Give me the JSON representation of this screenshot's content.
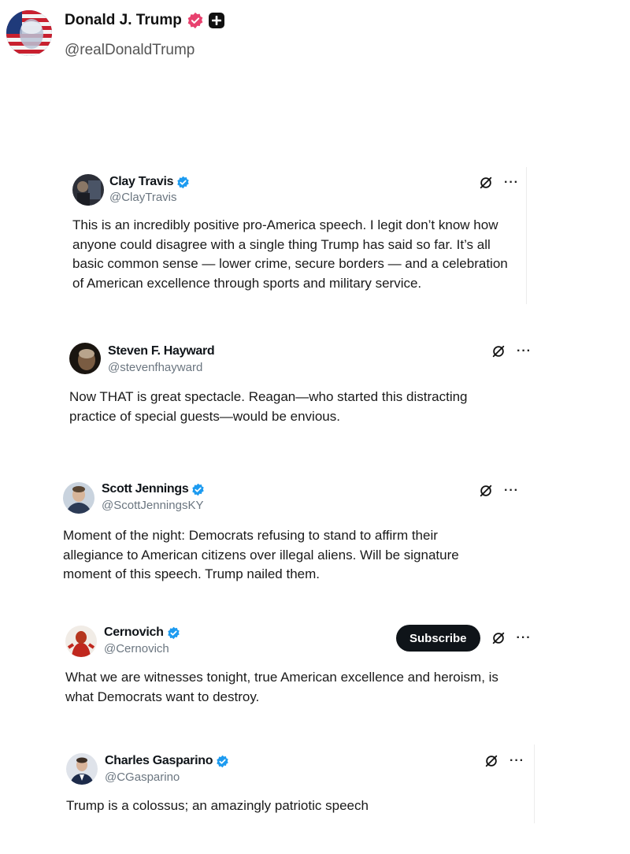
{
  "post": {
    "author_name": "Donald J. Trump",
    "author_handle": "@realDonaldTrump"
  },
  "tweets": [
    {
      "name": "Clay Travis",
      "handle": "@ClayTravis",
      "verified": true,
      "lines": [
        "This is an incredibly positive pro-America speech. I legit don’t know how",
        "anyone could disagree with a single thing Trump has said so far. It’s all",
        "basic common sense — lower crime, secure borders — and a celebration",
        "of American excellence through sports and military service."
      ]
    },
    {
      "name": "Steven F. Hayward",
      "handle": "@stevenfhayward",
      "verified": false,
      "lines": [
        "Now THAT is great spectacle. Reagan—who started this distracting",
        "practice of special guests—would be envious."
      ]
    },
    {
      "name": "Scott Jennings",
      "handle": "@ScottJenningsKY",
      "verified": true,
      "lines": [
        "Moment of the night: Democrats refusing to stand to affirm their",
        "allegiance to American citizens over illegal aliens. Will be signature",
        "moment of this speech. Trump nailed them."
      ]
    },
    {
      "name": "Cernovich",
      "handle": "@Cernovich",
      "verified": true,
      "subscribe_label": "Subscribe",
      "lines": [
        "What we are witnesses tonight, true American excellence and heroism, is",
        "what Democrats want to destroy."
      ]
    },
    {
      "name": "Charles Gasparino",
      "handle": "@CGasparino",
      "verified": true,
      "lines": [
        "Trump is a colossus; an amazingly patriotic speech"
      ]
    }
  ],
  "icons": {
    "verified_pink": "verified-badge-icon",
    "plus_badge": "plus-badge-icon",
    "verified_blue": "verified-check-icon",
    "grok": "grok-icon",
    "more": "more-icon"
  },
  "colors": {
    "verified_pink": "#e8416e",
    "verified_blue": "#1d9bf0",
    "subscribe_bg": "#0f1419"
  },
  "more_glyph": "···"
}
